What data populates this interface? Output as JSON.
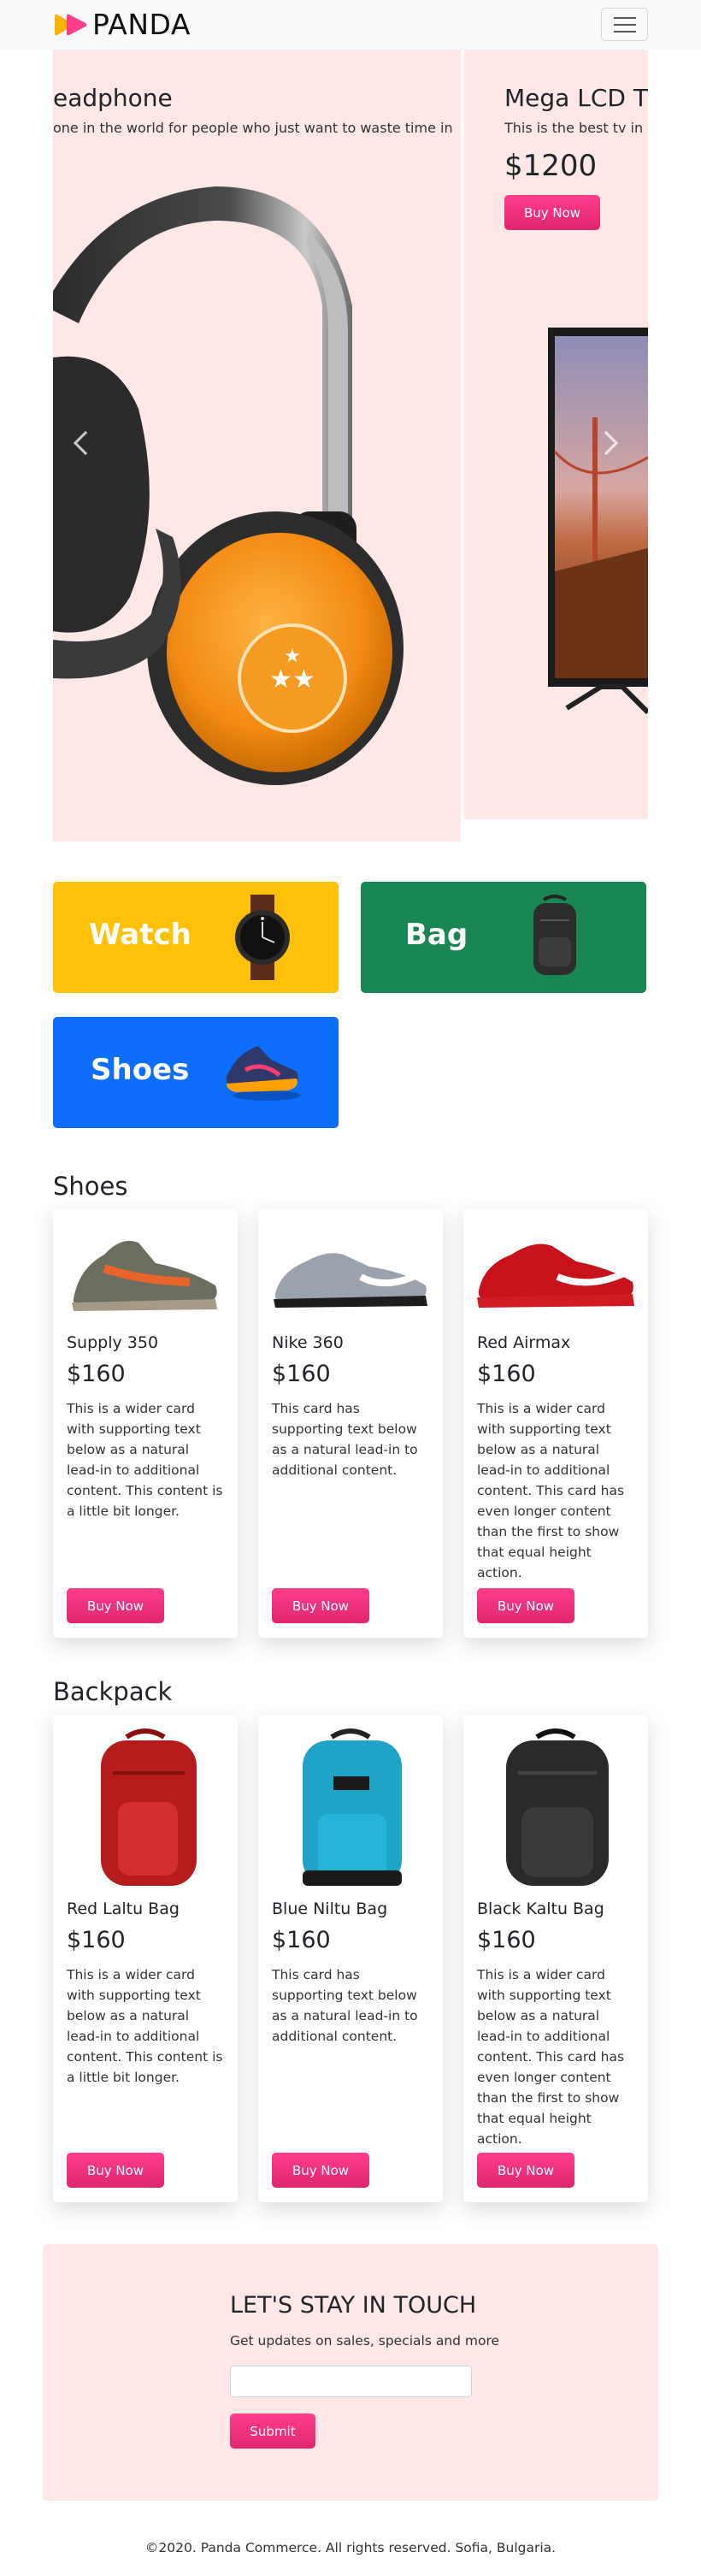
{
  "navbar": {
    "brand": "PANDA",
    "logo_icon": "panda-play-logo",
    "menu_icon": "hamburger-icon",
    "colors": {
      "logo_pink": "#ff3d8b",
      "logo_orange": "#ffb300"
    }
  },
  "carousel": {
    "slides": [
      {
        "title": "eadphone",
        "description": "one in the world for people who just want to waste time in",
        "image": "orange-headphones"
      },
      {
        "title": "Mega LCD TV",
        "description": "This is the best tv in the",
        "price": "$1200",
        "button": "Buy Now",
        "image": "lcd-tv"
      }
    ],
    "prev_icon": "chevron-left-icon",
    "next_icon": "chevron-right-icon"
  },
  "categories": [
    {
      "label": "Watch",
      "color": "#ffc107",
      "icon": "wristwatch-icon"
    },
    {
      "label": "Bag",
      "color": "#198754",
      "icon": "backpack-icon"
    },
    {
      "label": "Shoes",
      "color": "#0d6efd",
      "icon": "sneaker-icon"
    }
  ],
  "shoes": {
    "title": "Shoes",
    "items": [
      {
        "name": "Supply 350",
        "price": "$160",
        "text": "This is a wider card with supporting text below as a natural lead-in to additional content. This content is a little bit longer.",
        "button": "Buy Now"
      },
      {
        "name": "Nike 360",
        "price": "$160",
        "text": "This card has supporting text below as a natural lead-in to additional content.",
        "button": "Buy Now"
      },
      {
        "name": "Red Airmax",
        "price": "$160",
        "text": "This is a wider card with supporting text below as a natural lead-in to additional content. This card has even longer content than the first to show that equal height action.",
        "button": "Buy Now"
      }
    ]
  },
  "backpacks": {
    "title": "Backpack",
    "items": [
      {
        "name": "Red Laltu Bag",
        "price": "$160",
        "text": "This is a wider card with supporting text below as a natural lead-in to additional content. This content is a little bit longer.",
        "button": "Buy Now"
      },
      {
        "name": "Blue Niltu Bag",
        "price": "$160",
        "text": "This card has supporting text below as a natural lead-in to additional content.",
        "button": "Buy Now"
      },
      {
        "name": "Black Kaltu Bag",
        "price": "$160",
        "text": "This is a wider card with supporting text below as a natural lead-in to additional content. This card has even longer content than the first to show that equal height action.",
        "button": "Buy Now"
      }
    ]
  },
  "newsletter": {
    "title": "LET'S STAY IN TOUCH",
    "subtitle": "Get updates on sales, specials and more",
    "input_value": "",
    "button": "Submit"
  },
  "footer": {
    "text": "©2020. Panda Commerce. All rights reserved. Sofia, Bulgaria."
  }
}
